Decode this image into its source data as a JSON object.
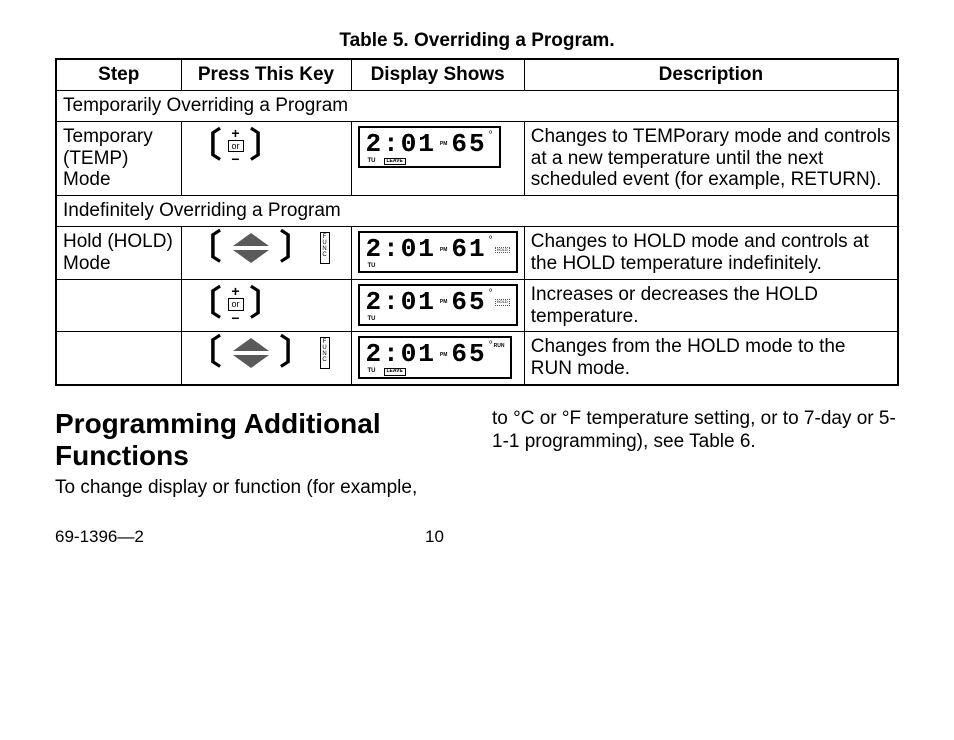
{
  "table": {
    "caption": "Table 5. Overriding a Program.",
    "headers": {
      "step": "Step",
      "key": "Press This Key",
      "display": "Display Shows",
      "desc": "Description"
    },
    "section1": "Temporarily Overriding a Program",
    "section2": "Indefinitely Overriding a Program",
    "rows": [
      {
        "step": "Temporary (TEMP) Mode",
        "key_type": "plus_or_minus",
        "display": {
          "time": "2:01",
          "ampm": "PM",
          "temp": "65",
          "day": "TU",
          "leave": true
        },
        "desc": "Changes to TEMPorary mode and controls at a new temperature until the next scheduled event (for example, RETURN)."
      },
      {
        "step": "Hold (HOLD) Mode",
        "key_type": "arrows_func",
        "display": {
          "time": "2:01",
          "ampm": "PM",
          "temp": "61",
          "day": "TU",
          "hold": true
        },
        "desc": "Changes to HOLD mode and controls at the HOLD temperature indefinitely."
      },
      {
        "step": "",
        "key_type": "plus_or_minus",
        "display": {
          "time": "2:01",
          "ampm": "PM",
          "temp": "65",
          "day": "TU",
          "hold": true
        },
        "desc": "Increases or decreases the HOLD temperature."
      },
      {
        "step": "",
        "key_type": "arrows_func",
        "display": {
          "time": "2:01",
          "ampm": "PM",
          "temp": "65",
          "day": "TU",
          "run": true,
          "leave": true
        },
        "desc": "Changes from the HOLD mode to the RUN mode."
      }
    ]
  },
  "body": {
    "heading": "Programming Additional Functions",
    "para_left": "To change display or function (for example,",
    "para_right": "to °C or °F temperature setting, or to 7-day or 5-1-1 programming), see Table 6."
  },
  "footer": {
    "docnum": "69-1396—2",
    "page": "10"
  },
  "key_labels": {
    "or": "or",
    "func": "FUNC"
  }
}
